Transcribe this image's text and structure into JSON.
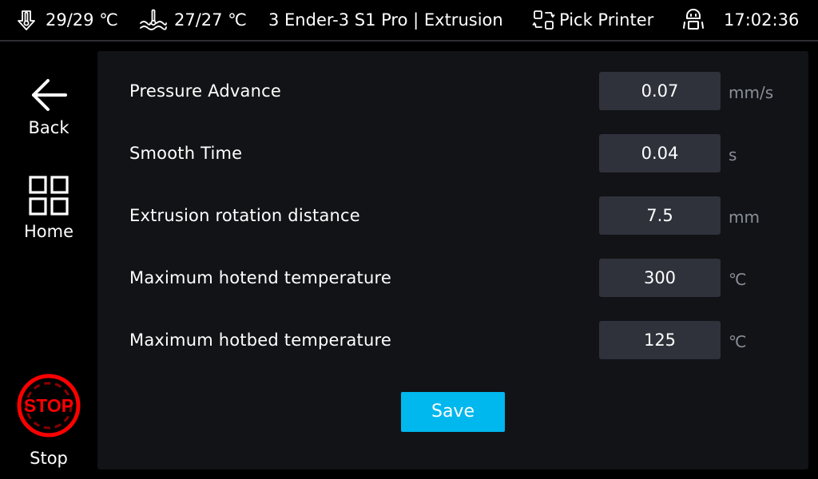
{
  "header": {
    "nozzle_temp": "29/29 ℃",
    "nozzle_temp_icon": "nozzle-thermometer-icon",
    "bed_temp": "27/27 ℃",
    "bed_temp_icon": "heated-bed-thermometer-icon",
    "title": "3 Ender-3 S1 Pro | Extrusion",
    "pick_printer_label": "Pick Printer",
    "pick_printer_icon": "switch-printer-icon",
    "robot_icon": "robot-icon",
    "clock": "17:02:36"
  },
  "sidebar": {
    "back": {
      "label": "Back",
      "icon": "arrow-left-icon"
    },
    "home": {
      "label": "Home",
      "icon": "grid-icon"
    },
    "stop": {
      "label": "Stop",
      "icon": "stop-sign-icon",
      "icon_text": "STOP",
      "color": "#ff0000"
    }
  },
  "settings": [
    {
      "label": "Pressure Advance",
      "value": "0.07",
      "unit": "mm/s"
    },
    {
      "label": "Smooth Time",
      "value": "0.04",
      "unit": "s"
    },
    {
      "label": "Extrusion rotation distance",
      "value": "7.5",
      "unit": "mm"
    },
    {
      "label": "Maximum hotend temperature",
      "value": "300",
      "unit": "℃"
    },
    {
      "label": "Maximum hotbed temperature",
      "value": "125",
      "unit": "℃"
    }
  ],
  "save": {
    "label": "Save",
    "color": "#00b7ee"
  },
  "colors": {
    "background": "#000000",
    "panel": "#121317",
    "input": "#2f323b",
    "unit_text": "#8a8f98",
    "divider": "#2e2e33"
  }
}
